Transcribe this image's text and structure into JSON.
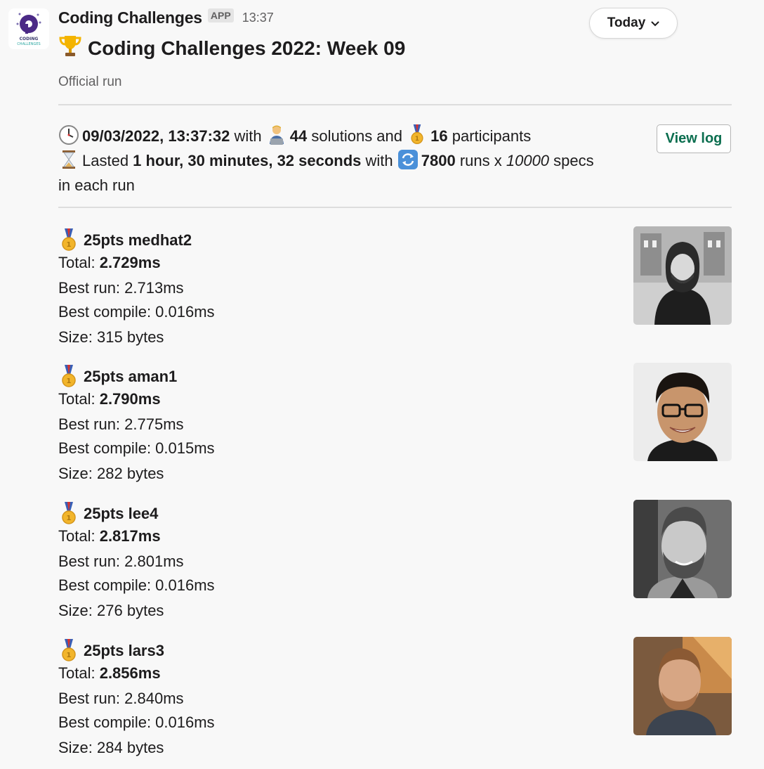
{
  "app": {
    "name": "Coding Challenges",
    "badge": "APP",
    "time": "13:37",
    "logo_text_1": "CODING",
    "logo_text_2": "CHALLENGES"
  },
  "date_button": {
    "label": "Today"
  },
  "message": {
    "title": "Coding Challenges 2022: Week 09",
    "subtitle": "Official run",
    "summary": {
      "datetime": "09/03/2022, 13:37:32",
      "with_1": " with ",
      "solutions_count": "44",
      "solutions_text": " solutions and ",
      "participants_count": "16",
      "participants_text": " participants",
      "lasted_text": "Lasted ",
      "duration": "1 hour, 30 minutes, 32 seconds",
      "with_2": " with ",
      "runs_count": "7800",
      "runs_text": " runs x ",
      "specs_count": "10000",
      "specs_text": " specs",
      "tail": "in each run"
    },
    "view_log_label": "View log"
  },
  "results": [
    {
      "rank_line": "25pts medhat2",
      "total_label": "Total: ",
      "total": "2.729ms",
      "best_run": "Best run: 2.713ms",
      "best_compile": "Best compile: 0.016ms",
      "size": "Size: 315 bytes"
    },
    {
      "rank_line": "25pts aman1",
      "total_label": "Total: ",
      "total": "2.790ms",
      "best_run": "Best run: 2.775ms",
      "best_compile": "Best compile: 0.015ms",
      "size": "Size: 282 bytes"
    },
    {
      "rank_line": "25pts lee4",
      "total_label": "Total: ",
      "total": "2.817ms",
      "best_run": "Best run: 2.801ms",
      "best_compile": "Best compile: 0.016ms",
      "size": "Size: 276 bytes"
    },
    {
      "rank_line": "25pts lars3",
      "total_label": "Total: ",
      "total": "2.856ms",
      "best_run": "Best run: 2.840ms",
      "best_compile": "Best compile: 0.016ms",
      "size": "Size: 284 bytes"
    }
  ],
  "icons": {
    "trophy": "trophy-icon",
    "clock": "clock-icon",
    "technologist": "technologist-icon",
    "medal": "medal-icon",
    "hourglass": "hourglass-icon",
    "repeat": "repeat-icon",
    "chevron": "chevron-down-icon"
  },
  "colors": {
    "accent_link": "#0b6e4f",
    "muted": "#616061",
    "medal_gold": "#f2b52b",
    "ribbon_blue": "#3a5fb5",
    "ribbon_red": "#d8322e"
  }
}
